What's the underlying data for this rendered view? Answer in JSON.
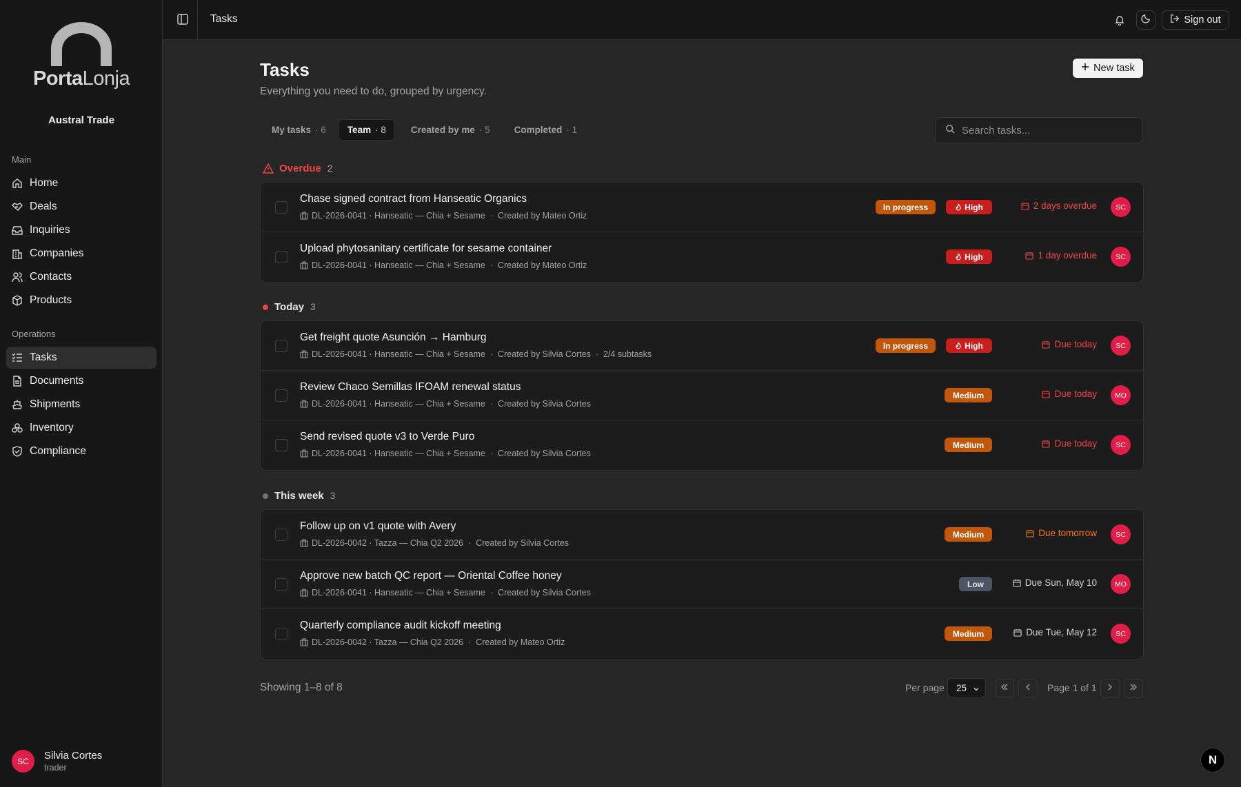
{
  "brand": {
    "logo_bold": "Porta",
    "logo_light": "Lonja",
    "org": "Austral Trade"
  },
  "sidebar": {
    "main_label": "Main",
    "main": [
      {
        "label": "Home",
        "icon": "home-icon"
      },
      {
        "label": "Deals",
        "icon": "handshake-icon"
      },
      {
        "label": "Inquiries",
        "icon": "inbox-icon"
      },
      {
        "label": "Companies",
        "icon": "building-icon"
      },
      {
        "label": "Contacts",
        "icon": "users-icon"
      },
      {
        "label": "Products",
        "icon": "package-icon"
      }
    ],
    "ops_label": "Operations",
    "ops": [
      {
        "label": "Tasks",
        "icon": "list-checks-icon",
        "active": true
      },
      {
        "label": "Documents",
        "icon": "file-icon"
      },
      {
        "label": "Shipments",
        "icon": "ship-icon"
      },
      {
        "label": "Inventory",
        "icon": "boxes-icon"
      },
      {
        "label": "Compliance",
        "icon": "shield-check-icon"
      }
    ]
  },
  "user": {
    "initials": "SC",
    "name": "Silvia Cortes",
    "role": "trader"
  },
  "topbar": {
    "title": "Tasks",
    "signout": "Sign out"
  },
  "page": {
    "title": "Tasks",
    "subtitle": "Everything you need to do, grouped by urgency.",
    "new_task": "New task",
    "search_placeholder": "Search tasks..."
  },
  "tabs": [
    {
      "label": "My tasks",
      "count": "· 6"
    },
    {
      "label": "Team",
      "count": "· 8",
      "active": true
    },
    {
      "label": "Created by me",
      "count": "· 5"
    },
    {
      "label": "Completed",
      "count": "· 1"
    }
  ],
  "groups": {
    "overdue": {
      "label": "Overdue",
      "count": "2",
      "tasks": [
        {
          "title": "Chase signed contract from Hanseatic Organics",
          "deal": "DL-2026-0041 · Hanseatic — Chia + Sesame",
          "creator": "Created by Mateo Ortiz",
          "status": "In progress",
          "priority": "High",
          "due": "2 days overdue",
          "assignee": "SC"
        },
        {
          "title": "Upload phytosanitary certificate for sesame container",
          "deal": "DL-2026-0041 · Hanseatic — Chia + Sesame",
          "creator": "Created by Mateo Ortiz",
          "priority": "High",
          "due": "1 day overdue",
          "assignee": "SC"
        }
      ]
    },
    "today": {
      "label": "Today",
      "count": "3",
      "tasks": [
        {
          "title": "Get freight quote Asunción → Hamburg",
          "deal": "DL-2026-0041 · Hanseatic — Chia + Sesame",
          "creator": "Created by Silvia Cortes",
          "subtasks": "2/4 subtasks",
          "status": "In progress",
          "priority": "High",
          "due": "Due today",
          "assignee": "SC"
        },
        {
          "title": "Review Chaco Semillas IFOAM renewal status",
          "deal": "DL-2026-0041 · Hanseatic — Chia + Sesame",
          "creator": "Created by Silvia Cortes",
          "priority": "Medium",
          "due": "Due today",
          "assignee": "MO"
        },
        {
          "title": "Send revised quote v3 to Verde Puro",
          "deal": "DL-2026-0041 · Hanseatic — Chia + Sesame",
          "creator": "Created by Silvia Cortes",
          "priority": "Medium",
          "due": "Due today",
          "assignee": "SC"
        }
      ]
    },
    "week": {
      "label": "This week",
      "count": "3",
      "tasks": [
        {
          "title": "Follow up on v1 quote with Avery",
          "deal": "DL-2026-0042 · Tazza — Chia Q2 2026",
          "creator": "Created by Silvia Cortes",
          "priority": "Medium",
          "due": "Due tomorrow",
          "assignee": "SC"
        },
        {
          "title": "Approve new batch QC report — Oriental Coffee honey",
          "deal": "DL-2026-0041 · Hanseatic — Chia + Sesame",
          "creator": "Created by Silvia Cortes",
          "priority": "Low",
          "due": "Due Sun, May 10",
          "assignee": "MO"
        },
        {
          "title": "Quarterly compliance audit kickoff meeting",
          "deal": "DL-2026-0042 · Tazza — Chia Q2 2026",
          "creator": "Created by Mateo Ortiz",
          "priority": "Medium",
          "due": "Due Tue, May 12",
          "assignee": "SC"
        }
      ]
    }
  },
  "footer": {
    "showing": "Showing 1–8 of 8",
    "per_page_label": "Per page",
    "per_page": "25",
    "page": "Page 1 of 1"
  },
  "colors": {
    "overdue": "#ef4444",
    "due_today": "#ef4444",
    "due_tomorrow": "#f97316",
    "accent_avatar": "#e11d48"
  },
  "floating_badge": "N"
}
